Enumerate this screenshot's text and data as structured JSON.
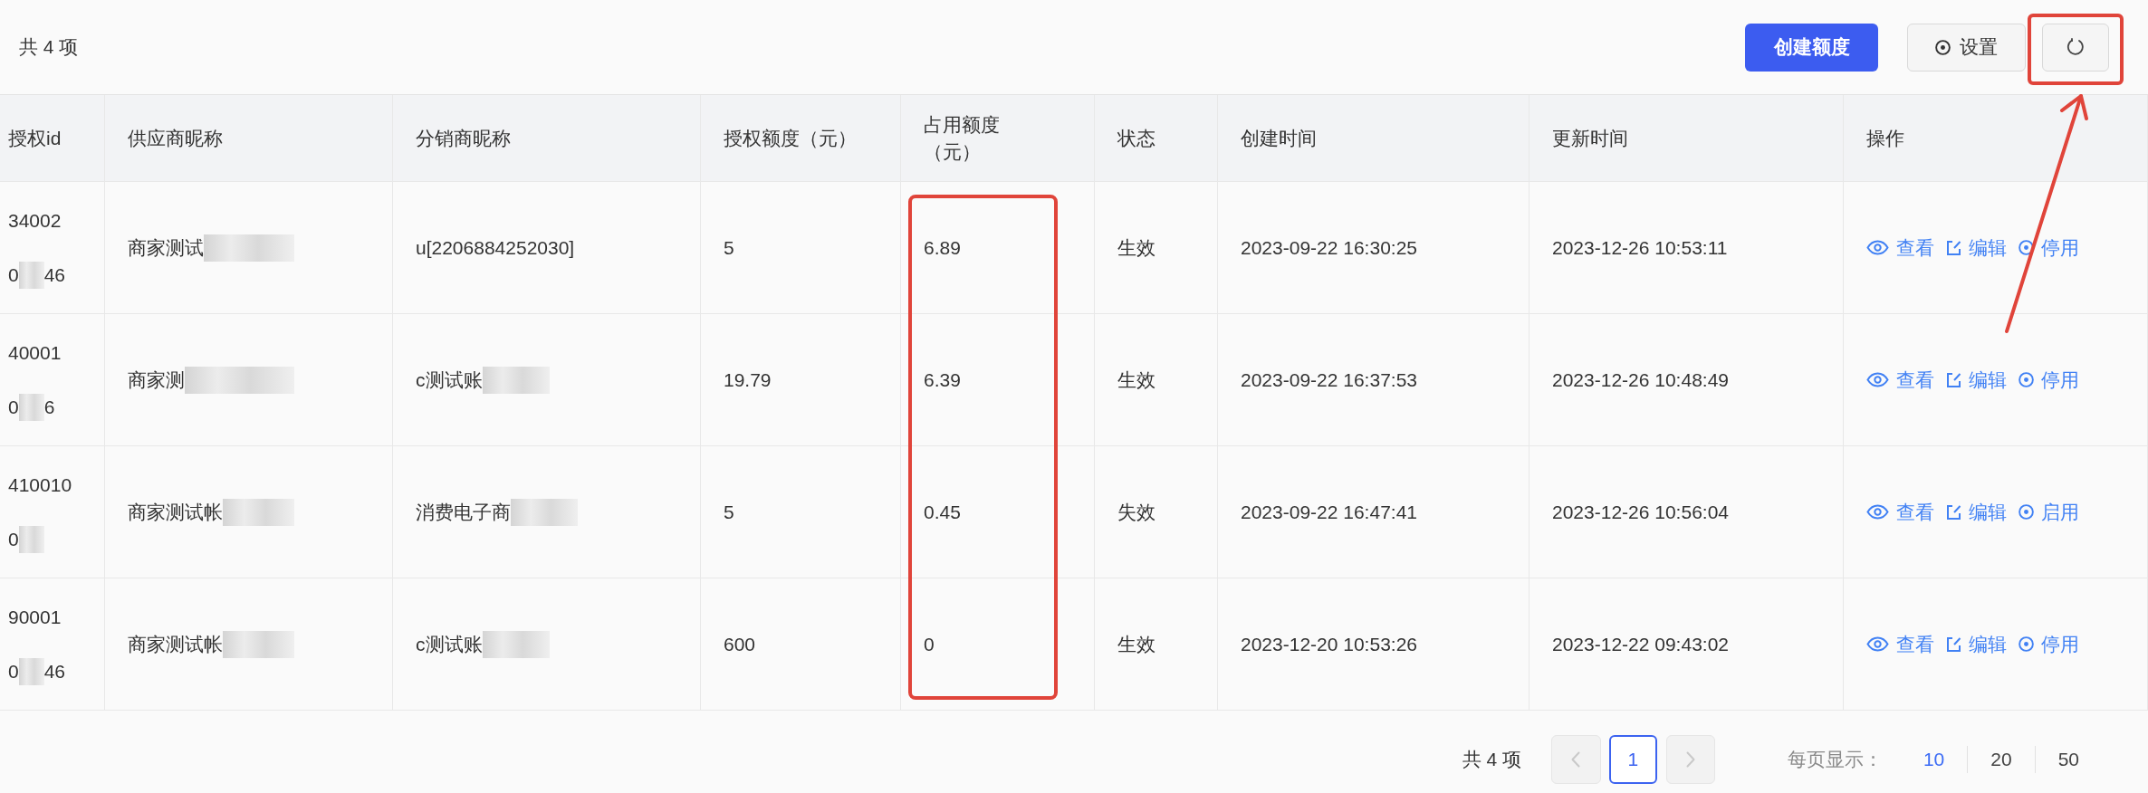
{
  "toolbar": {
    "total": "共 4 项",
    "create_button": "创建额度",
    "settings_button": "设置",
    "refresh": {
      "highlighted": true
    }
  },
  "table": {
    "columns": [
      {
        "label": "授权id",
        "highlighted": false
      },
      {
        "label": "供应商昵称",
        "highlighted": false
      },
      {
        "label": "分销商昵称",
        "highlighted": false
      },
      {
        "label": "授权额度（元）",
        "highlighted": false
      },
      {
        "label": "占用额度（元）",
        "highlighted": true
      },
      {
        "label": "状态",
        "highlighted": false
      },
      {
        "label": "创建时间",
        "highlighted": false
      },
      {
        "label": "更新时间",
        "highlighted": false
      },
      {
        "label": "操作",
        "highlighted": false
      }
    ],
    "rows": [
      {
        "id": {
          "line1": "34002",
          "line2": [
            {
              "kind": "text",
              "text": "0"
            },
            {
              "kind": "redacted"
            },
            {
              "kind": "text",
              "text": "46"
            }
          ]
        },
        "supplier": [
          {
            "kind": "text",
            "text": "商家测试"
          },
          {
            "kind": "redacted"
          }
        ],
        "distributor": [
          {
            "kind": "text",
            "text": "u[2206884252030]"
          }
        ],
        "authorized": "5",
        "used": "6.89",
        "status": "生效",
        "created": "2023-09-22 16:30:25",
        "updated": "2023-12-26 10:53:11",
        "actions": [
          {
            "kind": "view",
            "label": "查看"
          },
          {
            "kind": "edit",
            "label": "编辑"
          },
          {
            "kind": "toggle",
            "label": "停用"
          }
        ]
      },
      {
        "id": {
          "line1": "40001",
          "line2": [
            {
              "kind": "text",
              "text": "0"
            },
            {
              "kind": "redacted"
            },
            {
              "kind": "text",
              "text": "6"
            }
          ]
        },
        "supplier": [
          {
            "kind": "text",
            "text": "商家测"
          },
          {
            "kind": "redacted"
          }
        ],
        "distributor": [
          {
            "kind": "text",
            "text": "c测试账"
          },
          {
            "kind": "redacted"
          }
        ],
        "authorized": "19.79",
        "used": "6.39",
        "status": "生效",
        "created": "2023-09-22 16:37:53",
        "updated": "2023-12-26 10:48:49",
        "actions": [
          {
            "kind": "view",
            "label": "查看"
          },
          {
            "kind": "edit",
            "label": "编辑"
          },
          {
            "kind": "toggle",
            "label": "停用"
          }
        ]
      },
      {
        "id": {
          "line1": "410010",
          "line2": [
            {
              "kind": "text",
              "text": "0"
            },
            {
              "kind": "redacted"
            }
          ]
        },
        "supplier": [
          {
            "kind": "text",
            "text": "商家测试帐"
          },
          {
            "kind": "redacted"
          }
        ],
        "distributor": [
          {
            "kind": "text",
            "text": "消费电子商"
          },
          {
            "kind": "redacted"
          }
        ],
        "authorized": "5",
        "used": "0.45",
        "status": "失效",
        "created": "2023-09-22 16:47:41",
        "updated": "2023-12-26 10:56:04",
        "actions": [
          {
            "kind": "view",
            "label": "查看"
          },
          {
            "kind": "edit",
            "label": "编辑"
          },
          {
            "kind": "toggle",
            "label": "启用"
          }
        ]
      },
      {
        "id": {
          "line1": "90001",
          "line2": [
            {
              "kind": "text",
              "text": "0"
            },
            {
              "kind": "redacted"
            },
            {
              "kind": "text",
              "text": "46"
            }
          ]
        },
        "supplier": [
          {
            "kind": "text",
            "text": "商家测试帐"
          },
          {
            "kind": "redacted"
          }
        ],
        "distributor": [
          {
            "kind": "text",
            "text": "c测试账"
          },
          {
            "kind": "redacted"
          }
        ],
        "authorized": "600",
        "used": "0",
        "status": "生效",
        "created": "2023-12-20 10:53:26",
        "updated": "2023-12-22 09:43:02",
        "actions": [
          {
            "kind": "view",
            "label": "查看"
          },
          {
            "kind": "edit",
            "label": "编辑"
          },
          {
            "kind": "toggle",
            "label": "停用"
          }
        ]
      }
    ]
  },
  "pagination": {
    "total": "共 4 项",
    "prev": {
      "disabled": true
    },
    "pages": [
      {
        "label": "1",
        "selected": true
      }
    ],
    "next": {
      "disabled": true
    },
    "page_size_label": "每页显示：",
    "page_sizes": [
      {
        "label": "10",
        "selected": true
      },
      {
        "label": "20",
        "selected": false
      },
      {
        "label": "50",
        "selected": false
      }
    ]
  }
}
